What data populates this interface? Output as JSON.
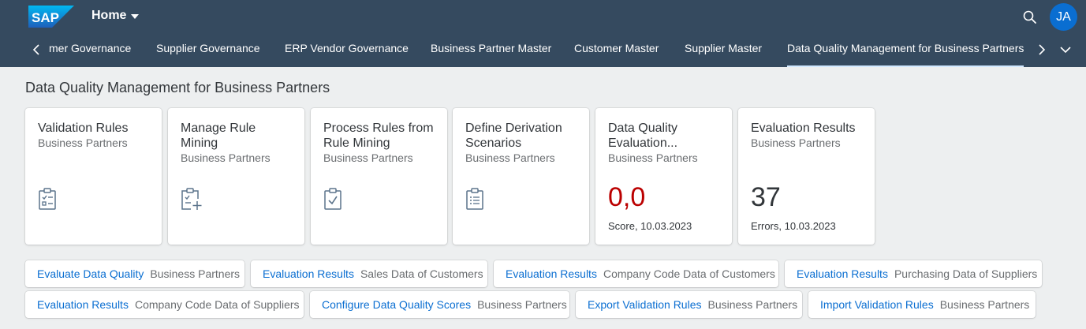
{
  "shell": {
    "logo_text": "SAP",
    "home_label": "Home",
    "avatar_initials": "JA",
    "colors": {
      "shell_bg": "#354a5f",
      "accent": "#0a6ed1",
      "error": "#bb0000"
    }
  },
  "tabs": [
    {
      "label": "mer Governance"
    },
    {
      "label": "Supplier Governance"
    },
    {
      "label": "ERP Vendor Governance"
    },
    {
      "label": "Business Partner Master"
    },
    {
      "label": "Customer Master"
    },
    {
      "label": "Supplier Master"
    },
    {
      "label": "Data Quality Management for Business Partners",
      "active": true
    }
  ],
  "page": {
    "title": "Data Quality Management for Business Partners"
  },
  "tiles": [
    {
      "title": "Validation Rules",
      "subtitle": "Business Partners",
      "icon": "clipboard-list-icon"
    },
    {
      "title": "Manage Rule Mining",
      "subtitle": "Business Partners",
      "icon": "clipboard-add-icon"
    },
    {
      "title": "Process Rules from Rule Mining",
      "subtitle": "Business Partners",
      "icon": "clipboard-check-icon"
    },
    {
      "title": "Define Derivation Scenarios",
      "subtitle": "Business Partners",
      "icon": "clipboard-lines-icon"
    },
    {
      "title": "Data Quality Evaluation...",
      "subtitle": "Business Partners",
      "kpi": "0,0",
      "footer": "Score, 10.03.2023"
    },
    {
      "title": "Evaluation Results",
      "subtitle": "Business Partners",
      "kpi": "37",
      "footer": "Errors, 10.03.2023"
    }
  ],
  "link_tiles": [
    {
      "title": "Evaluate Data Quality",
      "subtitle": "Business Partners"
    },
    {
      "title": "Evaluation Results",
      "subtitle": "Sales Data of Customers"
    },
    {
      "title": "Evaluation Results",
      "subtitle": "Company Code Data of Customers"
    },
    {
      "title": "Evaluation Results",
      "subtitle": "Purchasing Data of Suppliers"
    },
    {
      "title": "Evaluation Results",
      "subtitle": "Company Code Data of Suppliers"
    },
    {
      "title": "Configure Data Quality Scores",
      "subtitle": "Business Partners"
    },
    {
      "title": "Export Validation Rules",
      "subtitle": "Business Partners"
    },
    {
      "title": "Import Validation Rules",
      "subtitle": "Business Partners"
    }
  ]
}
